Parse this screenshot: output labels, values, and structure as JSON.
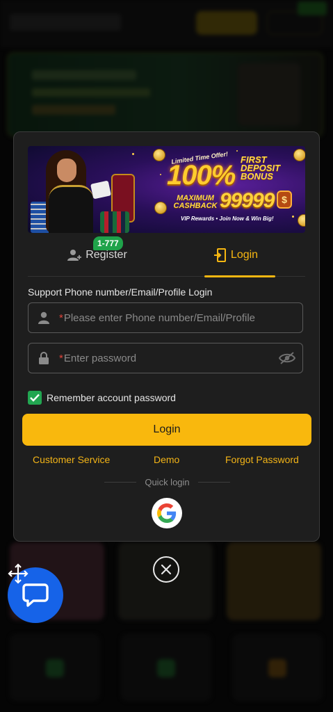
{
  "promo_banner": {
    "limited": "Limited Time Offer!",
    "headline_percent": "100%",
    "headline_first": "FIRST DEPOSIT BONUS",
    "cashback_label": "MAXIMUM CASHBACK",
    "cashback_amount": "99999",
    "currency_symbol": "$",
    "tagline": "VIP Rewards • Join Now & Win Big!"
  },
  "tabs": {
    "register_label": "Register",
    "register_badge": "1-777",
    "login_label": "Login",
    "active": "login"
  },
  "form": {
    "support_label": "Support Phone number/Email/Profile Login",
    "username_placeholder": "Please enter Phone number/Email/Profile",
    "password_placeholder": "Enter password",
    "required_mark": "*",
    "remember_label": "Remember account password",
    "remember_checked": true,
    "login_button": "Login"
  },
  "links": {
    "customer_service": "Customer Service",
    "demo": "Demo",
    "forgot_password": "Forgot Password"
  },
  "quick_login": {
    "label": "Quick login",
    "providers": [
      "google"
    ]
  },
  "colors": {
    "accent": "#f9b80d",
    "badge": "#1fa34a",
    "checkbox": "#22a651",
    "chat_fab": "#1663e8",
    "modal_bg": "#1e1e1e",
    "required": "#e0443a"
  },
  "icons": {
    "register": "person-add-icon",
    "login": "door-login-icon",
    "username": "person-icon",
    "password": "lock-icon",
    "toggle_password": "eye-off-icon",
    "google": "google-icon",
    "close": "close-icon",
    "chat": "chat-bubble-icon",
    "move": "move-arrows-icon"
  }
}
